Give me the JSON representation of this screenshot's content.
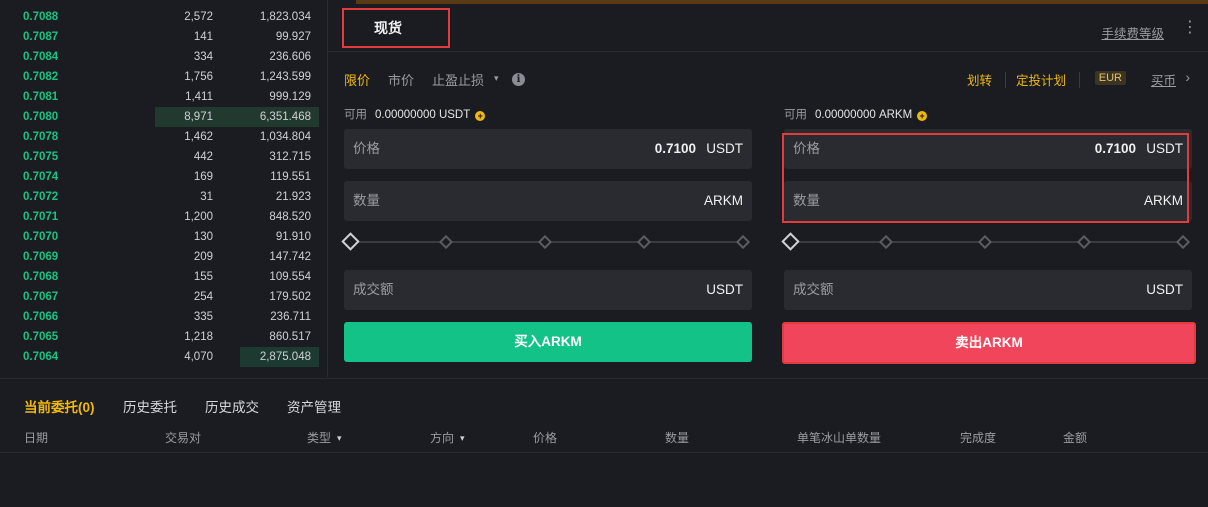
{
  "orderbook": {
    "rows": [
      {
        "price": "0.7088",
        "qty": "2,572",
        "total": "1,823.034",
        "depth": 0.0
      },
      {
        "price": "0.7087",
        "qty": "141",
        "total": "99.927",
        "depth": 0.0
      },
      {
        "price": "0.7084",
        "qty": "334",
        "total": "236.606",
        "depth": 0.0
      },
      {
        "price": "0.7082",
        "qty": "1,756",
        "total": "1,243.599",
        "depth": 0.0
      },
      {
        "price": "0.7081",
        "qty": "1,411",
        "total": "999.129",
        "depth": 0.0
      },
      {
        "price": "0.7080",
        "qty": "8,971",
        "total": "6,351.468",
        "depth": 1.0
      },
      {
        "price": "0.7078",
        "qty": "1,462",
        "total": "1,034.804",
        "depth": 0.0
      },
      {
        "price": "0.7075",
        "qty": "442",
        "total": "312.715",
        "depth": 0.0
      },
      {
        "price": "0.7074",
        "qty": "169",
        "total": "119.551",
        "depth": 0.0
      },
      {
        "price": "0.7072",
        "qty": "31",
        "total": "21.923",
        "depth": 0.0
      },
      {
        "price": "0.7071",
        "qty": "1,200",
        "total": "848.520",
        "depth": 0.0
      },
      {
        "price": "0.7070",
        "qty": "130",
        "total": "91.910",
        "depth": 0.0
      },
      {
        "price": "0.7069",
        "qty": "209",
        "total": "147.742",
        "depth": 0.0
      },
      {
        "price": "0.7068",
        "qty": "155",
        "total": "109.554",
        "depth": 0.0
      },
      {
        "price": "0.7067",
        "qty": "254",
        "total": "179.502",
        "depth": 0.0
      },
      {
        "price": "0.7066",
        "qty": "335",
        "total": "236.711",
        "depth": 0.0
      },
      {
        "price": "0.7065",
        "qty": "1,218",
        "total": "860.517",
        "depth": 0.0
      },
      {
        "price": "0.7064",
        "qty": "4,070",
        "total": "2,875.048",
        "depth": 0.48
      }
    ]
  },
  "trade": {
    "tab_spot": "现货",
    "fee_level": "手续费等级",
    "more_glyph": "⋮",
    "order_types": {
      "limit": "限价",
      "market": "市价",
      "stop": "止盈止损",
      "caret": "▾",
      "info": "i"
    },
    "links": {
      "transfer": "划转",
      "plan": "定投计划",
      "eur": "EUR",
      "buy_coin": "买币",
      "chevron": "›"
    },
    "buy": {
      "avail_label": "可用",
      "avail_value": "0.00000000 USDT",
      "price_label": "价格",
      "price_value": "0.7100",
      "price_unit": "USDT",
      "qty_label": "数量",
      "qty_unit": "ARKM",
      "total_label": "成交额",
      "total_unit": "USDT",
      "button": "买入ARKM"
    },
    "sell": {
      "avail_label": "可用",
      "avail_value": "0.00000000 ARKM",
      "price_label": "价格",
      "price_value": "0.7100",
      "price_unit": "USDT",
      "qty_label": "数量",
      "qty_unit": "ARKM",
      "total_label": "成交额",
      "total_unit": "USDT",
      "button": "卖出ARKM"
    },
    "plus_glyph": "+"
  },
  "bottom": {
    "tabs": {
      "current": "当前委托(0)",
      "history": "历史委托",
      "trades": "历史成交",
      "assets": "资产管理"
    },
    "columns": {
      "date": "日期",
      "pair": "交易对",
      "type": "类型",
      "side": "方向",
      "price": "价格",
      "qty": "数量",
      "iceberg": "单笔冰山单数量",
      "fill": "完成度",
      "amount": "金额"
    },
    "caret": "▾"
  },
  "colors": {
    "buy": "#12c286",
    "sell": "#f0455a",
    "accent": "#f0b90b",
    "highlight": "#e33b3b"
  }
}
